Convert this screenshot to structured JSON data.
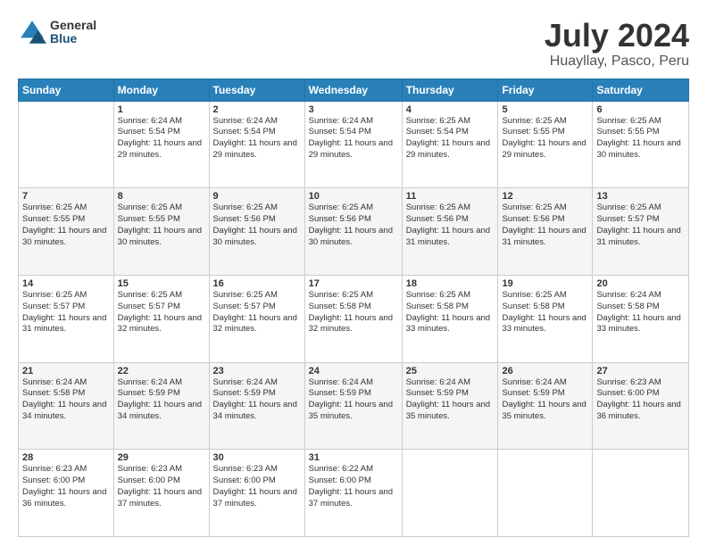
{
  "logo": {
    "general": "General",
    "blue": "Blue"
  },
  "title": "July 2024",
  "subtitle": "Huayllay, Pasco, Peru",
  "headers": [
    "Sunday",
    "Monday",
    "Tuesday",
    "Wednesday",
    "Thursday",
    "Friday",
    "Saturday"
  ],
  "weeks": [
    [
      {
        "day": "",
        "sunrise": "",
        "sunset": "",
        "daylight": ""
      },
      {
        "day": "1",
        "sunrise": "Sunrise: 6:24 AM",
        "sunset": "Sunset: 5:54 PM",
        "daylight": "Daylight: 11 hours and 29 minutes."
      },
      {
        "day": "2",
        "sunrise": "Sunrise: 6:24 AM",
        "sunset": "Sunset: 5:54 PM",
        "daylight": "Daylight: 11 hours and 29 minutes."
      },
      {
        "day": "3",
        "sunrise": "Sunrise: 6:24 AM",
        "sunset": "Sunset: 5:54 PM",
        "daylight": "Daylight: 11 hours and 29 minutes."
      },
      {
        "day": "4",
        "sunrise": "Sunrise: 6:25 AM",
        "sunset": "Sunset: 5:54 PM",
        "daylight": "Daylight: 11 hours and 29 minutes."
      },
      {
        "day": "5",
        "sunrise": "Sunrise: 6:25 AM",
        "sunset": "Sunset: 5:55 PM",
        "daylight": "Daylight: 11 hours and 29 minutes."
      },
      {
        "day": "6",
        "sunrise": "Sunrise: 6:25 AM",
        "sunset": "Sunset: 5:55 PM",
        "daylight": "Daylight: 11 hours and 30 minutes."
      }
    ],
    [
      {
        "day": "7",
        "sunrise": "Sunrise: 6:25 AM",
        "sunset": "Sunset: 5:55 PM",
        "daylight": "Daylight: 11 hours and 30 minutes."
      },
      {
        "day": "8",
        "sunrise": "Sunrise: 6:25 AM",
        "sunset": "Sunset: 5:55 PM",
        "daylight": "Daylight: 11 hours and 30 minutes."
      },
      {
        "day": "9",
        "sunrise": "Sunrise: 6:25 AM",
        "sunset": "Sunset: 5:56 PM",
        "daylight": "Daylight: 11 hours and 30 minutes."
      },
      {
        "day": "10",
        "sunrise": "Sunrise: 6:25 AM",
        "sunset": "Sunset: 5:56 PM",
        "daylight": "Daylight: 11 hours and 30 minutes."
      },
      {
        "day": "11",
        "sunrise": "Sunrise: 6:25 AM",
        "sunset": "Sunset: 5:56 PM",
        "daylight": "Daylight: 11 hours and 31 minutes."
      },
      {
        "day": "12",
        "sunrise": "Sunrise: 6:25 AM",
        "sunset": "Sunset: 5:56 PM",
        "daylight": "Daylight: 11 hours and 31 minutes."
      },
      {
        "day": "13",
        "sunrise": "Sunrise: 6:25 AM",
        "sunset": "Sunset: 5:57 PM",
        "daylight": "Daylight: 11 hours and 31 minutes."
      }
    ],
    [
      {
        "day": "14",
        "sunrise": "Sunrise: 6:25 AM",
        "sunset": "Sunset: 5:57 PM",
        "daylight": "Daylight: 11 hours and 31 minutes."
      },
      {
        "day": "15",
        "sunrise": "Sunrise: 6:25 AM",
        "sunset": "Sunset: 5:57 PM",
        "daylight": "Daylight: 11 hours and 32 minutes."
      },
      {
        "day": "16",
        "sunrise": "Sunrise: 6:25 AM",
        "sunset": "Sunset: 5:57 PM",
        "daylight": "Daylight: 11 hours and 32 minutes."
      },
      {
        "day": "17",
        "sunrise": "Sunrise: 6:25 AM",
        "sunset": "Sunset: 5:58 PM",
        "daylight": "Daylight: 11 hours and 32 minutes."
      },
      {
        "day": "18",
        "sunrise": "Sunrise: 6:25 AM",
        "sunset": "Sunset: 5:58 PM",
        "daylight": "Daylight: 11 hours and 33 minutes."
      },
      {
        "day": "19",
        "sunrise": "Sunrise: 6:25 AM",
        "sunset": "Sunset: 5:58 PM",
        "daylight": "Daylight: 11 hours and 33 minutes."
      },
      {
        "day": "20",
        "sunrise": "Sunrise: 6:24 AM",
        "sunset": "Sunset: 5:58 PM",
        "daylight": "Daylight: 11 hours and 33 minutes."
      }
    ],
    [
      {
        "day": "21",
        "sunrise": "Sunrise: 6:24 AM",
        "sunset": "Sunset: 5:58 PM",
        "daylight": "Daylight: 11 hours and 34 minutes."
      },
      {
        "day": "22",
        "sunrise": "Sunrise: 6:24 AM",
        "sunset": "Sunset: 5:59 PM",
        "daylight": "Daylight: 11 hours and 34 minutes."
      },
      {
        "day": "23",
        "sunrise": "Sunrise: 6:24 AM",
        "sunset": "Sunset: 5:59 PM",
        "daylight": "Daylight: 11 hours and 34 minutes."
      },
      {
        "day": "24",
        "sunrise": "Sunrise: 6:24 AM",
        "sunset": "Sunset: 5:59 PM",
        "daylight": "Daylight: 11 hours and 35 minutes."
      },
      {
        "day": "25",
        "sunrise": "Sunrise: 6:24 AM",
        "sunset": "Sunset: 5:59 PM",
        "daylight": "Daylight: 11 hours and 35 minutes."
      },
      {
        "day": "26",
        "sunrise": "Sunrise: 6:24 AM",
        "sunset": "Sunset: 5:59 PM",
        "daylight": "Daylight: 11 hours and 35 minutes."
      },
      {
        "day": "27",
        "sunrise": "Sunrise: 6:23 AM",
        "sunset": "Sunset: 6:00 PM",
        "daylight": "Daylight: 11 hours and 36 minutes."
      }
    ],
    [
      {
        "day": "28",
        "sunrise": "Sunrise: 6:23 AM",
        "sunset": "Sunset: 6:00 PM",
        "daylight": "Daylight: 11 hours and 36 minutes."
      },
      {
        "day": "29",
        "sunrise": "Sunrise: 6:23 AM",
        "sunset": "Sunset: 6:00 PM",
        "daylight": "Daylight: 11 hours and 37 minutes."
      },
      {
        "day": "30",
        "sunrise": "Sunrise: 6:23 AM",
        "sunset": "Sunset: 6:00 PM",
        "daylight": "Daylight: 11 hours and 37 minutes."
      },
      {
        "day": "31",
        "sunrise": "Sunrise: 6:22 AM",
        "sunset": "Sunset: 6:00 PM",
        "daylight": "Daylight: 11 hours and 37 minutes."
      },
      {
        "day": "",
        "sunrise": "",
        "sunset": "",
        "daylight": ""
      },
      {
        "day": "",
        "sunrise": "",
        "sunset": "",
        "daylight": ""
      },
      {
        "day": "",
        "sunrise": "",
        "sunset": "",
        "daylight": ""
      }
    ]
  ]
}
